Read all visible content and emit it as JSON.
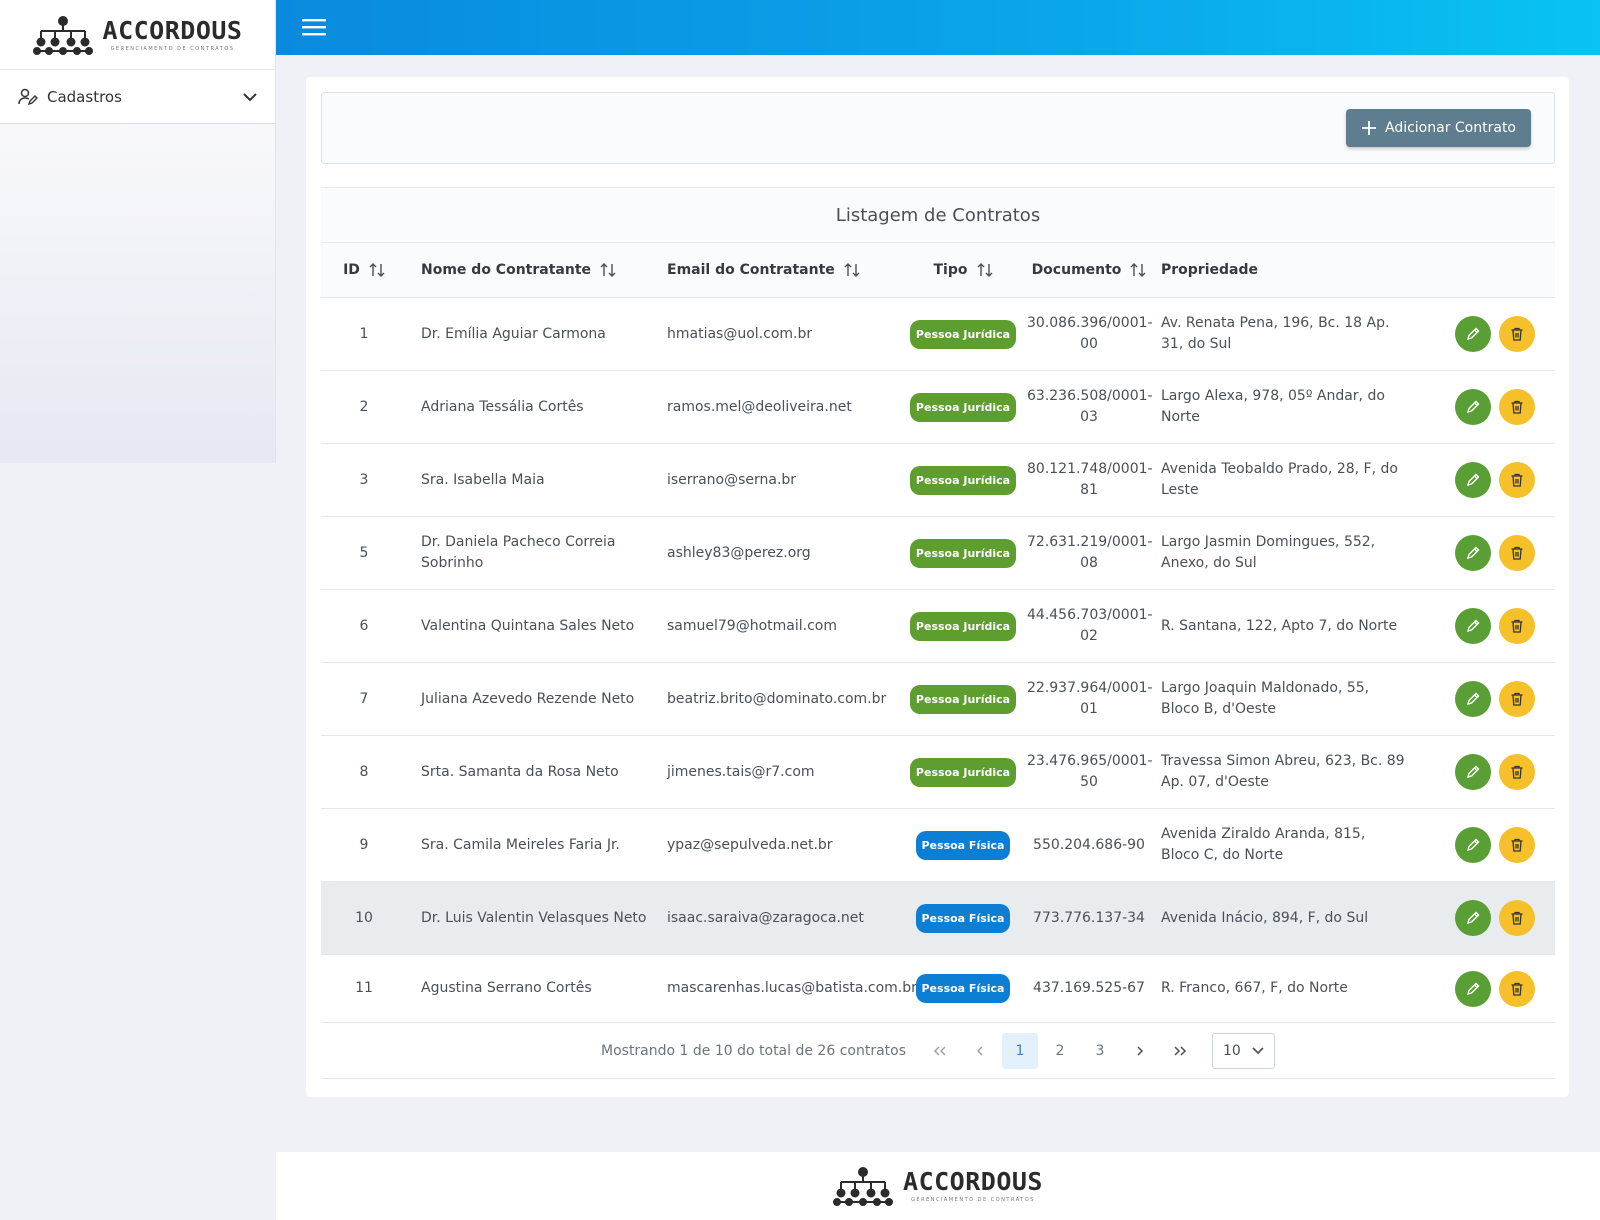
{
  "brand": {
    "name": "ACCORDOUS",
    "subtitle": "GERENCIAMENTO DE CONTRATOS"
  },
  "sidebar": {
    "items": [
      {
        "label": "Cadastros",
        "icon": "user-edit-icon"
      }
    ]
  },
  "toolbar": {
    "add_label": "Adicionar Contrato"
  },
  "table": {
    "title": "Listagem de Contratos",
    "columns": [
      "ID",
      "Nome do Contratante",
      "Email do Contratante",
      "Tipo",
      "Documento",
      "Propriedade"
    ],
    "rows": [
      {
        "id": "1",
        "nome": "Dr. Emília Aguiar Carmona",
        "email": "hmatias@uol.com.br",
        "tipo": "Pessoa Jurídica",
        "documento": "30.086.396/0001-00",
        "propriedade": "Av. Renata Pena, 196, Bc. 18 Ap. 31, do Sul"
      },
      {
        "id": "2",
        "nome": "Adriana Tessália Cortês",
        "email": "ramos.mel@deoliveira.net",
        "tipo": "Pessoa Jurídica",
        "documento": "63.236.508/0001-03",
        "propriedade": "Largo Alexa, 978, 05º Andar, do Norte"
      },
      {
        "id": "3",
        "nome": "Sra. Isabella Maia",
        "email": "iserrano@serna.br",
        "tipo": "Pessoa Jurídica",
        "documento": "80.121.748/0001-81",
        "propriedade": "Avenida Teobaldo Prado, 28, F, do Leste"
      },
      {
        "id": "5",
        "nome": "Dr. Daniela Pacheco Correia Sobrinho",
        "email": "ashley83@perez.org",
        "tipo": "Pessoa Jurídica",
        "documento": "72.631.219/0001-08",
        "propriedade": "Largo Jasmin Domingues, 552, Anexo, do Sul"
      },
      {
        "id": "6",
        "nome": "Valentina Quintana Sales Neto",
        "email": "samuel79@hotmail.com",
        "tipo": "Pessoa Jurídica",
        "documento": "44.456.703/0001-02",
        "propriedade": "R. Santana, 122, Apto 7, do Norte"
      },
      {
        "id": "7",
        "nome": "Juliana Azevedo Rezende Neto",
        "email": "beatriz.brito@dominato.com.br",
        "tipo": "Pessoa Jurídica",
        "documento": "22.937.964/0001-01",
        "propriedade": "Largo Joaquin Maldonado, 55, Bloco B, d'Oeste"
      },
      {
        "id": "8",
        "nome": "Srta. Samanta da Rosa Neto",
        "email": "jimenes.tais@r7.com",
        "tipo": "Pessoa Jurídica",
        "documento": "23.476.965/0001-50",
        "propriedade": "Travessa Simon Abreu, 623, Bc. 89 Ap. 07, d'Oeste"
      },
      {
        "id": "9",
        "nome": "Sra. Camila Meireles Faria Jr.",
        "email": "ypaz@sepulveda.net.br",
        "tipo": "Pessoa Física",
        "documento": "550.204.686-90",
        "propriedade": "Avenida Ziraldo Aranda, 815, Bloco C, do Norte"
      },
      {
        "id": "10",
        "nome": "Dr. Luis Valentin Velasques Neto",
        "email": "isaac.saraiva@zaragoca.net",
        "tipo": "Pessoa Física",
        "documento": "773.776.137-34",
        "propriedade": "Avenida Inácio, 894, F, do Sul"
      },
      {
        "id": "11",
        "nome": "Agustina Serrano Cortês",
        "email": "mascarenhas.lucas@batista.com.br",
        "tipo": "Pessoa Física",
        "documento": "437.169.525-67",
        "propriedade": "R. Franco, 667, F, do Norte"
      }
    ]
  },
  "pagination": {
    "info": "Mostrando 1 de 10 do total de 26 contratos",
    "pages": [
      "1",
      "2",
      "3"
    ],
    "current": "1",
    "per_page": "10"
  },
  "colors": {
    "topbar_start": "#0a8ade",
    "topbar_end": "#09c3f4",
    "juridica": "#5d9e2f",
    "fisica": "#0c7fd4",
    "edit": "#5a9e36",
    "delete": "#f5c02a",
    "add_button": "#5e7d8f"
  }
}
